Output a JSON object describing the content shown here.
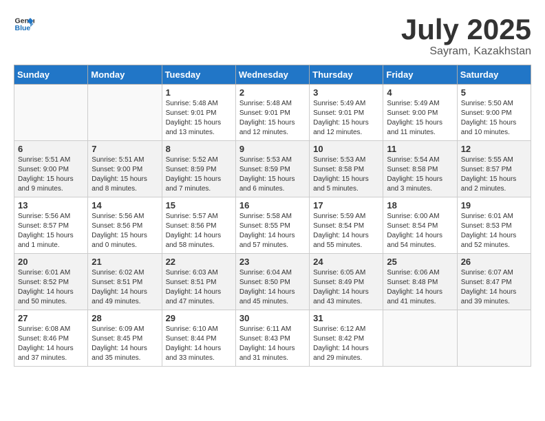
{
  "logo": {
    "general": "General",
    "blue": "Blue"
  },
  "title": "July 2025",
  "subtitle": "Sayram, Kazakhstan",
  "weekdays": [
    "Sunday",
    "Monday",
    "Tuesday",
    "Wednesday",
    "Thursday",
    "Friday",
    "Saturday"
  ],
  "weeks": [
    [
      {
        "day": null
      },
      {
        "day": null
      },
      {
        "day": "1",
        "sunrise": "Sunrise: 5:48 AM",
        "sunset": "Sunset: 9:01 PM",
        "daylight": "Daylight: 15 hours and 13 minutes."
      },
      {
        "day": "2",
        "sunrise": "Sunrise: 5:48 AM",
        "sunset": "Sunset: 9:01 PM",
        "daylight": "Daylight: 15 hours and 12 minutes."
      },
      {
        "day": "3",
        "sunrise": "Sunrise: 5:49 AM",
        "sunset": "Sunset: 9:01 PM",
        "daylight": "Daylight: 15 hours and 12 minutes."
      },
      {
        "day": "4",
        "sunrise": "Sunrise: 5:49 AM",
        "sunset": "Sunset: 9:00 PM",
        "daylight": "Daylight: 15 hours and 11 minutes."
      },
      {
        "day": "5",
        "sunrise": "Sunrise: 5:50 AM",
        "sunset": "Sunset: 9:00 PM",
        "daylight": "Daylight: 15 hours and 10 minutes."
      }
    ],
    [
      {
        "day": "6",
        "sunrise": "Sunrise: 5:51 AM",
        "sunset": "Sunset: 9:00 PM",
        "daylight": "Daylight: 15 hours and 9 minutes."
      },
      {
        "day": "7",
        "sunrise": "Sunrise: 5:51 AM",
        "sunset": "Sunset: 9:00 PM",
        "daylight": "Daylight: 15 hours and 8 minutes."
      },
      {
        "day": "8",
        "sunrise": "Sunrise: 5:52 AM",
        "sunset": "Sunset: 8:59 PM",
        "daylight": "Daylight: 15 hours and 7 minutes."
      },
      {
        "day": "9",
        "sunrise": "Sunrise: 5:53 AM",
        "sunset": "Sunset: 8:59 PM",
        "daylight": "Daylight: 15 hours and 6 minutes."
      },
      {
        "day": "10",
        "sunrise": "Sunrise: 5:53 AM",
        "sunset": "Sunset: 8:58 PM",
        "daylight": "Daylight: 15 hours and 5 minutes."
      },
      {
        "day": "11",
        "sunrise": "Sunrise: 5:54 AM",
        "sunset": "Sunset: 8:58 PM",
        "daylight": "Daylight: 15 hours and 3 minutes."
      },
      {
        "day": "12",
        "sunrise": "Sunrise: 5:55 AM",
        "sunset": "Sunset: 8:57 PM",
        "daylight": "Daylight: 15 hours and 2 minutes."
      }
    ],
    [
      {
        "day": "13",
        "sunrise": "Sunrise: 5:56 AM",
        "sunset": "Sunset: 8:57 PM",
        "daylight": "Daylight: 15 hours and 1 minute."
      },
      {
        "day": "14",
        "sunrise": "Sunrise: 5:56 AM",
        "sunset": "Sunset: 8:56 PM",
        "daylight": "Daylight: 15 hours and 0 minutes."
      },
      {
        "day": "15",
        "sunrise": "Sunrise: 5:57 AM",
        "sunset": "Sunset: 8:56 PM",
        "daylight": "Daylight: 14 hours and 58 minutes."
      },
      {
        "day": "16",
        "sunrise": "Sunrise: 5:58 AM",
        "sunset": "Sunset: 8:55 PM",
        "daylight": "Daylight: 14 hours and 57 minutes."
      },
      {
        "day": "17",
        "sunrise": "Sunrise: 5:59 AM",
        "sunset": "Sunset: 8:54 PM",
        "daylight": "Daylight: 14 hours and 55 minutes."
      },
      {
        "day": "18",
        "sunrise": "Sunrise: 6:00 AM",
        "sunset": "Sunset: 8:54 PM",
        "daylight": "Daylight: 14 hours and 54 minutes."
      },
      {
        "day": "19",
        "sunrise": "Sunrise: 6:01 AM",
        "sunset": "Sunset: 8:53 PM",
        "daylight": "Daylight: 14 hours and 52 minutes."
      }
    ],
    [
      {
        "day": "20",
        "sunrise": "Sunrise: 6:01 AM",
        "sunset": "Sunset: 8:52 PM",
        "daylight": "Daylight: 14 hours and 50 minutes."
      },
      {
        "day": "21",
        "sunrise": "Sunrise: 6:02 AM",
        "sunset": "Sunset: 8:51 PM",
        "daylight": "Daylight: 14 hours and 49 minutes."
      },
      {
        "day": "22",
        "sunrise": "Sunrise: 6:03 AM",
        "sunset": "Sunset: 8:51 PM",
        "daylight": "Daylight: 14 hours and 47 minutes."
      },
      {
        "day": "23",
        "sunrise": "Sunrise: 6:04 AM",
        "sunset": "Sunset: 8:50 PM",
        "daylight": "Daylight: 14 hours and 45 minutes."
      },
      {
        "day": "24",
        "sunrise": "Sunrise: 6:05 AM",
        "sunset": "Sunset: 8:49 PM",
        "daylight": "Daylight: 14 hours and 43 minutes."
      },
      {
        "day": "25",
        "sunrise": "Sunrise: 6:06 AM",
        "sunset": "Sunset: 8:48 PM",
        "daylight": "Daylight: 14 hours and 41 minutes."
      },
      {
        "day": "26",
        "sunrise": "Sunrise: 6:07 AM",
        "sunset": "Sunset: 8:47 PM",
        "daylight": "Daylight: 14 hours and 39 minutes."
      }
    ],
    [
      {
        "day": "27",
        "sunrise": "Sunrise: 6:08 AM",
        "sunset": "Sunset: 8:46 PM",
        "daylight": "Daylight: 14 hours and 37 minutes."
      },
      {
        "day": "28",
        "sunrise": "Sunrise: 6:09 AM",
        "sunset": "Sunset: 8:45 PM",
        "daylight": "Daylight: 14 hours and 35 minutes."
      },
      {
        "day": "29",
        "sunrise": "Sunrise: 6:10 AM",
        "sunset": "Sunset: 8:44 PM",
        "daylight": "Daylight: 14 hours and 33 minutes."
      },
      {
        "day": "30",
        "sunrise": "Sunrise: 6:11 AM",
        "sunset": "Sunset: 8:43 PM",
        "daylight": "Daylight: 14 hours and 31 minutes."
      },
      {
        "day": "31",
        "sunrise": "Sunrise: 6:12 AM",
        "sunset": "Sunset: 8:42 PM",
        "daylight": "Daylight: 14 hours and 29 minutes."
      },
      {
        "day": null
      },
      {
        "day": null
      }
    ]
  ]
}
